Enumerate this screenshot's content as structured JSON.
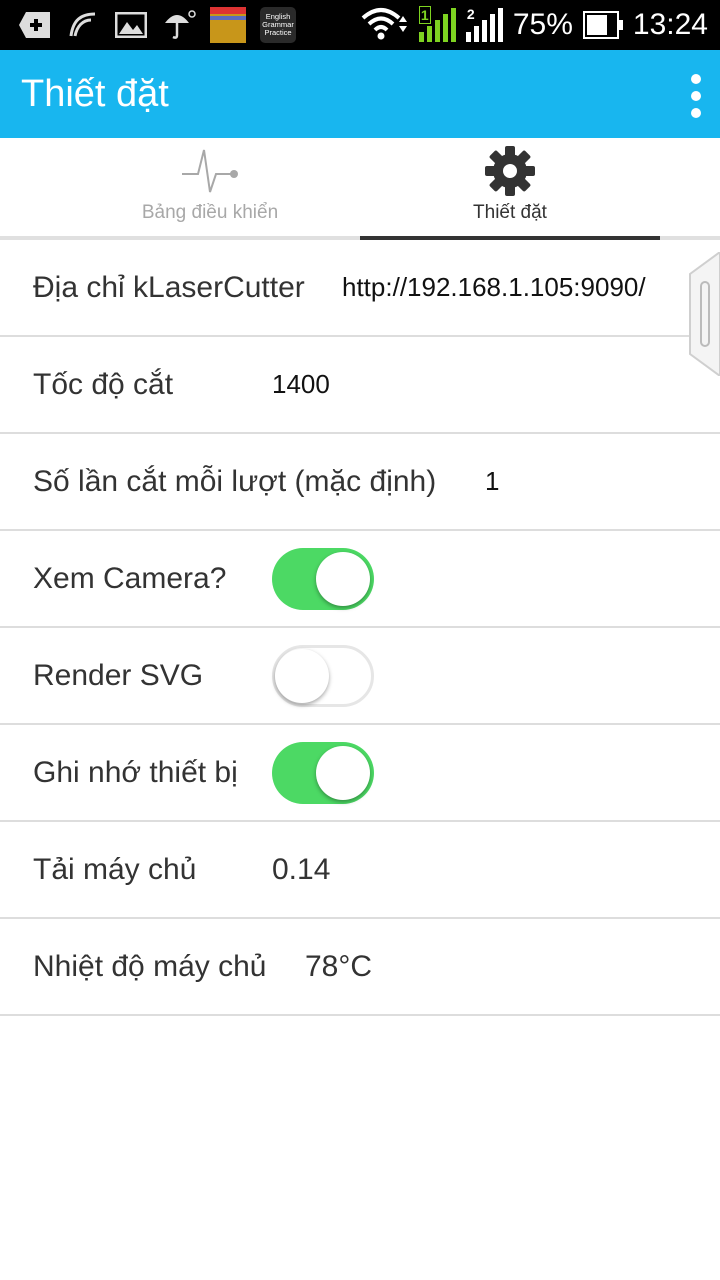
{
  "status_bar": {
    "battery": "75%",
    "time": "13:24",
    "sim1": "1",
    "sim2": "2",
    "app_icon_text": "English Grammar Practice"
  },
  "appbar": {
    "title": "Thiết đặt"
  },
  "tabs": [
    {
      "label": "Bảng điều khiển",
      "icon": "pulse-line-icon",
      "selected": false
    },
    {
      "label": "Thiết đặt",
      "icon": "gear-icon",
      "selected": true
    }
  ],
  "settings": {
    "laser_address": {
      "label": "Địa chỉ kLaserCutter",
      "value": "http://192.168.1.105:9090/"
    },
    "cut_speed": {
      "label": "Tốc độ cắt",
      "value": "1400"
    },
    "passes": {
      "label": "Số lần cắt mỗi lượt (mặc định)",
      "value": "1"
    },
    "camera": {
      "label": "Xem Camera?",
      "on": true
    },
    "render_svg": {
      "label": "Render SVG",
      "on": false
    },
    "remember_device": {
      "label": "Ghi nhớ thiết bị",
      "on": true
    },
    "server_load": {
      "label": "Tải máy chủ",
      "value": "0.14"
    },
    "server_temp": {
      "label": "Nhiệt độ máy chủ",
      "value": "78°C"
    }
  },
  "colors": {
    "appbar": "#18b6ef",
    "toggle_on": "#4cd964",
    "divider": "#dddddd"
  }
}
